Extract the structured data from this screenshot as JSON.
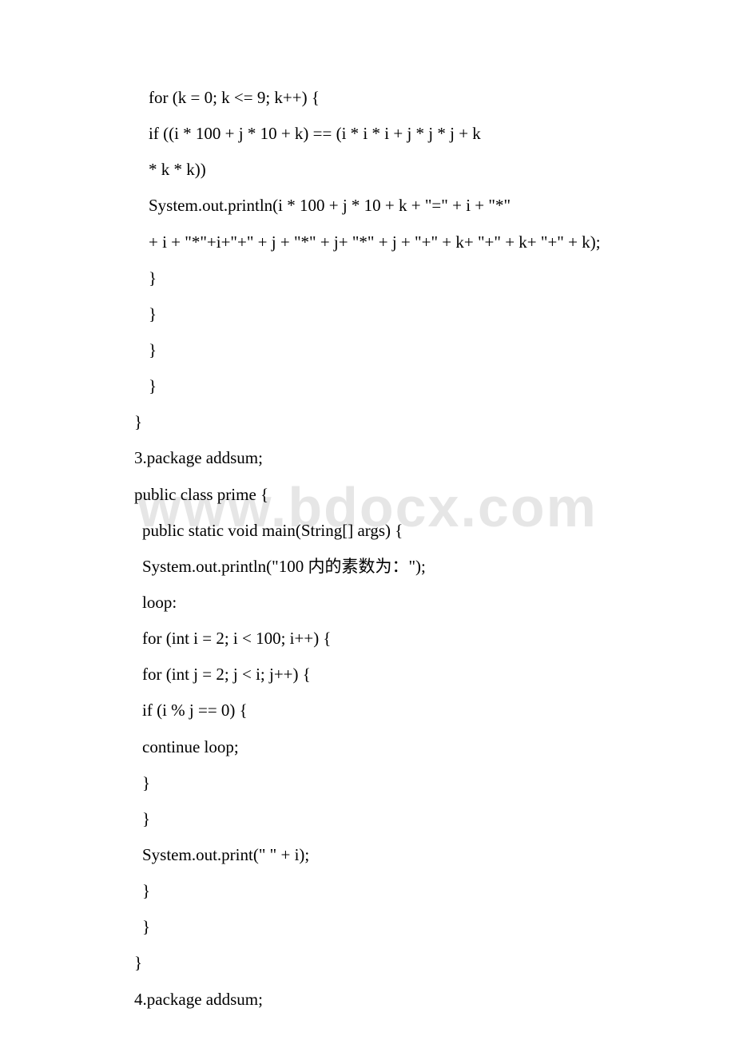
{
  "watermark": "www.bdocx.com",
  "lines": [
    {
      "cls": "indent2",
      "text": "for (k = 0; k <= 9; k++) {"
    },
    {
      "cls": "indent2",
      "text": "if ((i * 100 + j * 10 + k) == (i * i * i + j * j * j + k"
    },
    {
      "cls": "indent2",
      "text": "* k * k))"
    },
    {
      "cls": "indent2",
      "text": "System.out.println(i * 100 + j * 10 + k + \"=\" + i + \"*\""
    },
    {
      "cls": "indent2",
      "text": "+ i + \"*\"+i+\"+\" + j + \"*\" + j+ \"*\" + j + \"+\" + k+ \"+\" + k+ \"+\" + k);"
    },
    {
      "cls": "indent2",
      "text": "}"
    },
    {
      "cls": "indent2",
      "text": "}"
    },
    {
      "cls": "indent2",
      "text": "}"
    },
    {
      "cls": "indent2",
      "text": "}"
    },
    {
      "cls": "",
      "text": "}"
    },
    {
      "cls": "",
      "text": "3.package addsum;"
    },
    {
      "cls": "",
      "text": "public class prime {"
    },
    {
      "cls": "indent1",
      "text": "public static void main(String[] args) {"
    },
    {
      "cls": "indent1",
      "text": "System.out.println(\"100 内的素数为：\");"
    },
    {
      "cls": "indent1",
      "text": "loop:"
    },
    {
      "cls": "indent1",
      "text": "for (int i = 2; i < 100; i++) {"
    },
    {
      "cls": "indent1",
      "text": "for (int j = 2; j < i; j++) {"
    },
    {
      "cls": "indent1",
      "text": "if (i % j == 0) {"
    },
    {
      "cls": "indent1",
      "text": "continue loop;"
    },
    {
      "cls": "indent1",
      "text": "}"
    },
    {
      "cls": "indent1",
      "text": "}"
    },
    {
      "cls": "indent1",
      "text": "System.out.print(\" \" + i);"
    },
    {
      "cls": "indent1",
      "text": "}"
    },
    {
      "cls": "indent1",
      "text": "}"
    },
    {
      "cls": "",
      "text": "}"
    },
    {
      "cls": "",
      "text": "4.package addsum;"
    }
  ]
}
